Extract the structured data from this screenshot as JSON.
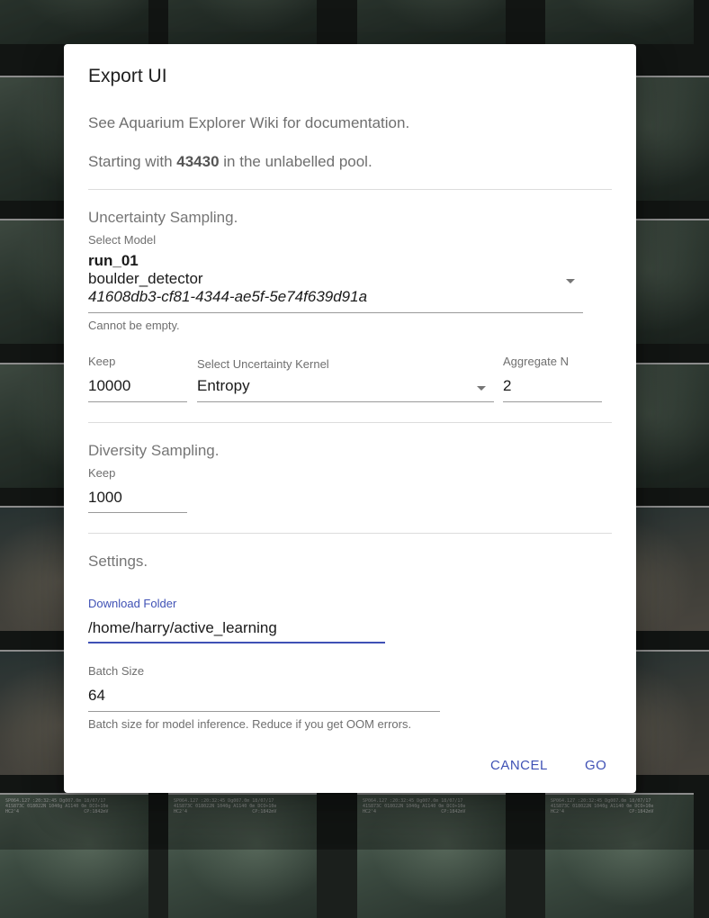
{
  "background": {
    "captions": [
      "SP064.127 :20:32:45 Dg007.0m 18/07/17\n41S873C 018022N 1040g A1140 0m DCO+10e\nHC2'4                        CP:1842mV",
      "SP064.127 :20:32:45 Dg007.0m 18/07/17\n41S873C 018022N 1040g A1140 0m DCO+10e\nHC2'4                        CP:1842mV"
    ]
  },
  "dialog": {
    "title": "Export UI",
    "wiki_text": "See Aquarium Explorer Wiki for documentation.",
    "pool_prefix": "Starting with ",
    "pool_count": "43430",
    "pool_suffix": " in the unlabelled pool.",
    "uncertainty": {
      "heading": "Uncertainty Sampling.",
      "model_label": "Select Model",
      "model_run": "run_01",
      "model_name": "boulder_detector",
      "model_id": "41608db3-cf81-4344-ae5f-5e74f639d91a",
      "model_error": "Cannot be empty.",
      "keep_label": "Keep",
      "keep_value": "10000",
      "kernel_label": "Select Uncertainty Kernel",
      "kernel_value": "Entropy",
      "aggregate_label": "Aggregate N",
      "aggregate_value": "2"
    },
    "diversity": {
      "heading": "Diversity Sampling.",
      "keep_label": "Keep",
      "keep_value": "1000"
    },
    "settings": {
      "heading": "Settings.",
      "folder_label": "Download Folder",
      "folder_value": "/home/harry/active_learning",
      "batch_label": "Batch Size",
      "batch_value": "64",
      "batch_helper": "Batch size for model inference. Reduce if you get OOM errors."
    },
    "actions": {
      "cancel": "CANCEL",
      "go": "GO"
    },
    "colors": {
      "accent": "#3f51b5"
    }
  }
}
